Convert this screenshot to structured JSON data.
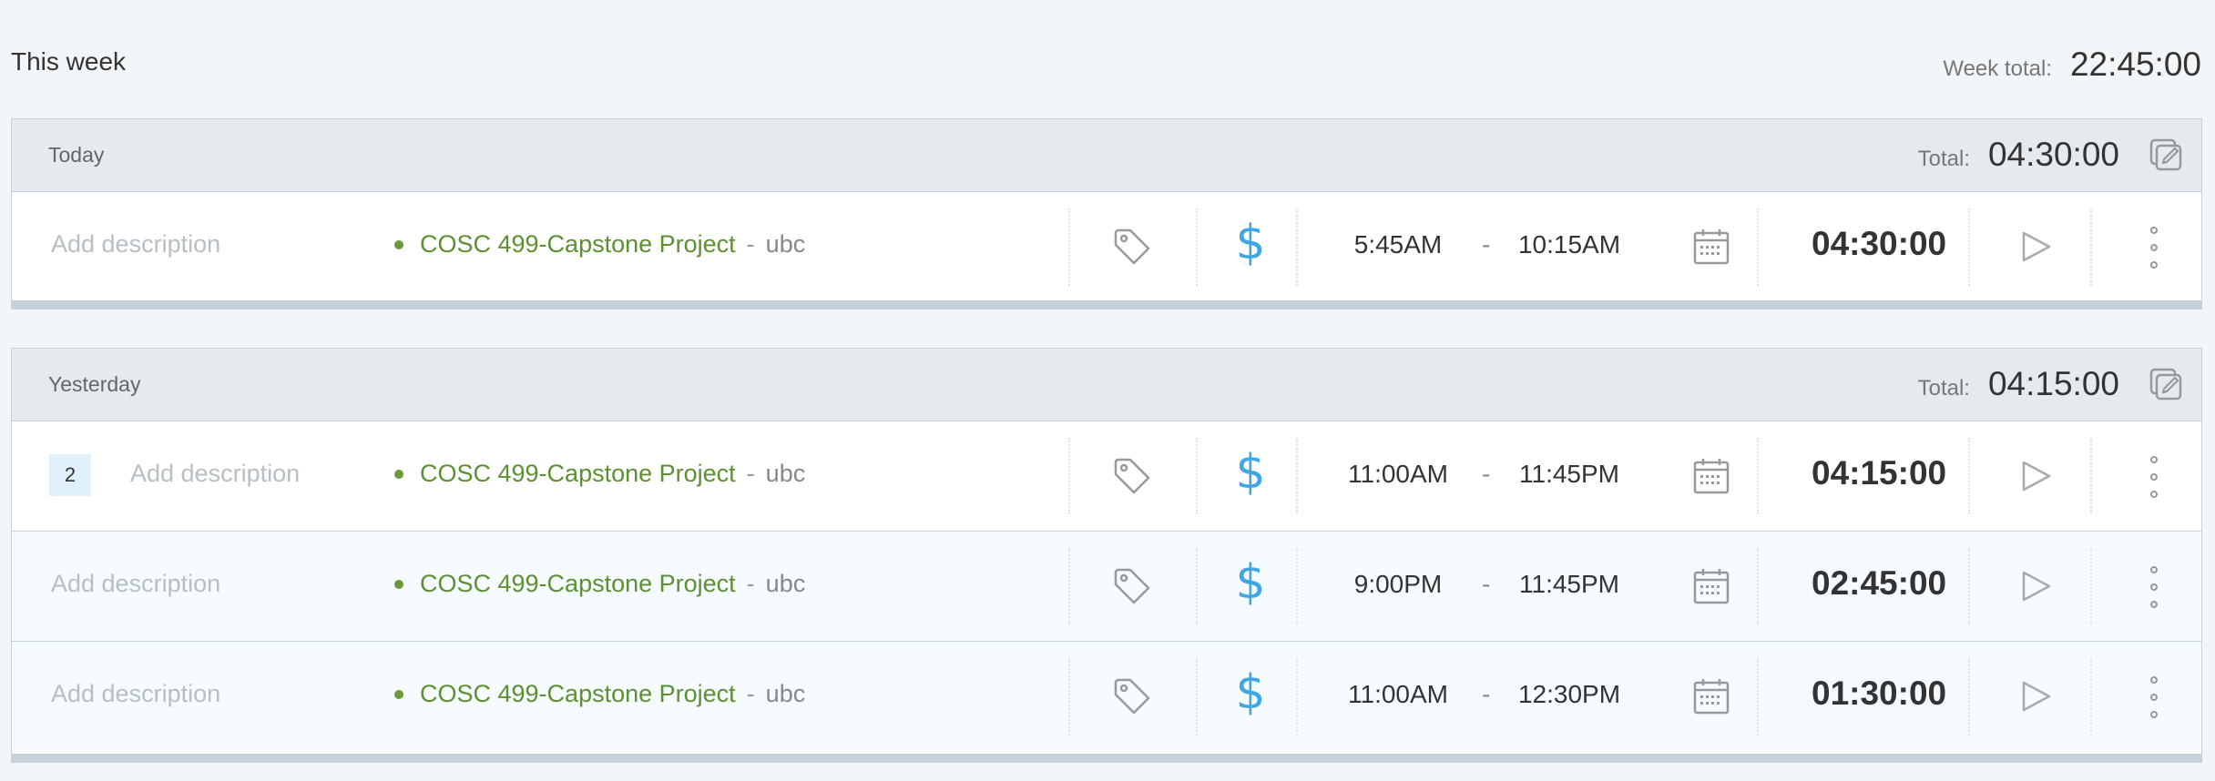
{
  "week": {
    "title": "This week",
    "total_label": "Week total:",
    "total_value": "22:45:00"
  },
  "colors": {
    "project": "#5d9033",
    "billable": "#3ea6e6",
    "header_bg": "#e4eaee"
  },
  "days": [
    {
      "label": "Today",
      "total_label": "Total:",
      "total_value": "04:30:00",
      "entries": [
        {
          "badge": "",
          "description": "Add description",
          "project": "COSC 499-Capstone Project",
          "separator": "-",
          "client": "ubc",
          "start": "5:45AM",
          "dash": "-",
          "end": "10:15AM",
          "duration": "04:30:00"
        }
      ]
    },
    {
      "label": "Yesterday",
      "total_label": "Total:",
      "total_value": "04:15:00",
      "entries": [
        {
          "badge": "2",
          "description": "Add description",
          "project": "COSC 499-Capstone Project",
          "separator": "-",
          "client": "ubc",
          "start": "11:00AM",
          "dash": "-",
          "end": "11:45PM",
          "duration": "04:15:00"
        },
        {
          "badge": "",
          "description": "Add description",
          "project": "COSC 499-Capstone Project",
          "separator": "-",
          "client": "ubc",
          "start": "9:00PM",
          "dash": "-",
          "end": "11:45PM",
          "duration": "02:45:00"
        },
        {
          "badge": "",
          "description": "Add description",
          "project": "COSC 499-Capstone Project",
          "separator": "-",
          "client": "ubc",
          "start": "11:00AM",
          "dash": "-",
          "end": "12:30PM",
          "duration": "01:30:00"
        }
      ]
    }
  ],
  "icons": {
    "tag": "tag-icon",
    "billable": "dollar-icon",
    "calendar": "calendar-icon",
    "play": "play-icon",
    "more": "more-icon",
    "bulk_edit": "bulk-edit-icon"
  }
}
